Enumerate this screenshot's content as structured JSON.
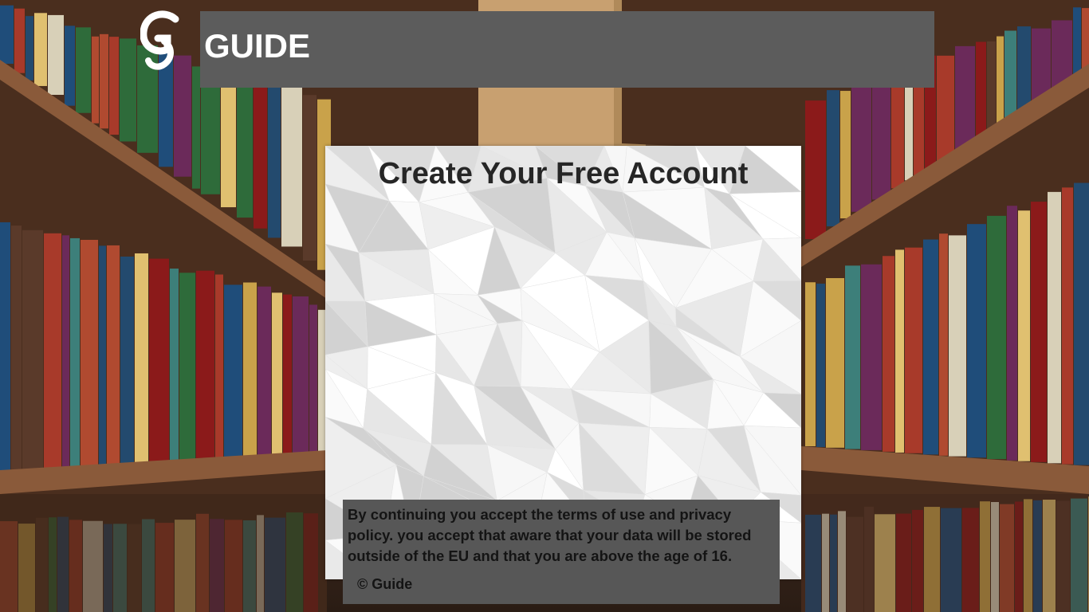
{
  "header": {
    "logo_alt": "G",
    "brand_name": "GUIDE"
  },
  "card": {
    "title": "Create Your Free Account"
  },
  "footer": {
    "terms_text": "By continuing you accept the terms of use and privacy policy. you accept that aware that your data will be stored outside of the EU and that you are above the age of 16.",
    "copyright": "© Guide"
  },
  "colors": {
    "header_bar": "#5c5c5c",
    "footer_box": "#575757",
    "title_text": "#262626",
    "brand_text": "#ffffff"
  }
}
